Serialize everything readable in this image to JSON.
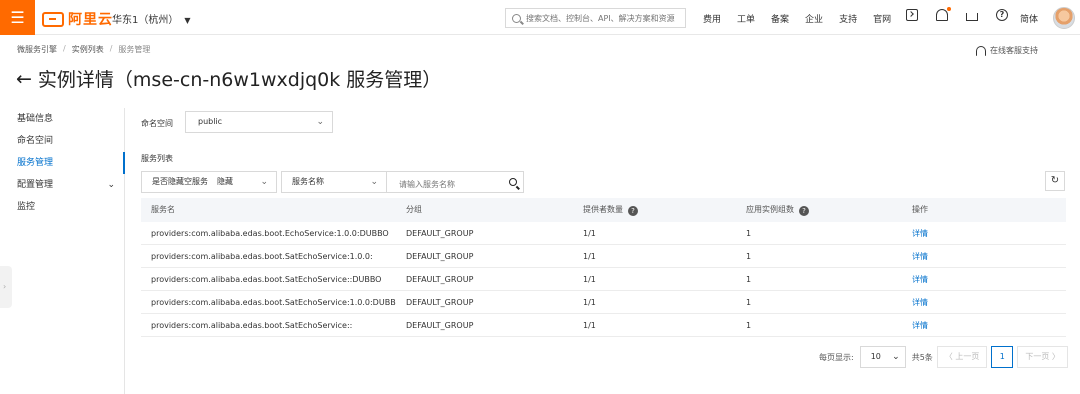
{
  "topbar": {
    "logo_text": "阿里云",
    "region": "华东1（杭州）",
    "search_placeholder": "搜索文档、控制台、API、解决方案和资源",
    "nav_links": [
      "费用",
      "工单",
      "备案",
      "企业",
      "支持",
      "官网"
    ],
    "lang": "简体",
    "accent_color": "#ff6a00"
  },
  "breadcrumb": {
    "items": [
      "微服务引擎",
      "实例列表",
      "服务管理"
    ],
    "sep": "/"
  },
  "support_label": "在线客服支持",
  "page_title": "实例详情（mse-cn-n6w1wxdjq0k 服务管理）",
  "sidebar": {
    "items": [
      {
        "label": "基础信息",
        "active": false
      },
      {
        "label": "命名空间",
        "active": false
      },
      {
        "label": "服务管理",
        "active": true
      },
      {
        "label": "配置管理",
        "active": false,
        "expandable": true
      },
      {
        "label": "监控",
        "active": false
      }
    ],
    "active_color": "#0070cc"
  },
  "namespace": {
    "label": "命名空间",
    "value": "public"
  },
  "service_list_label": "服务列表",
  "filters": {
    "hide_empty_label": "是否隐藏空服务",
    "hide_empty_value": "隐藏",
    "field_select": "服务名称",
    "search_placeholder": "请输入服务名称"
  },
  "table": {
    "columns": [
      "服务名",
      "分组",
      "提供者数量",
      "应用实例组数",
      "操作"
    ],
    "rows": [
      {
        "name": "providers:com.alibaba.edas.boot.EchoService:1.0.0:DUBBO",
        "group": "DEFAULT_GROUP",
        "providers": "1/1",
        "instances": "1",
        "action": "详情"
      },
      {
        "name": "providers:com.alibaba.edas.boot.SatEchoService:1.0.0:",
        "group": "DEFAULT_GROUP",
        "providers": "1/1",
        "instances": "1",
        "action": "详情"
      },
      {
        "name": "providers:com.alibaba.edas.boot.SatEchoService::DUBBO",
        "group": "DEFAULT_GROUP",
        "providers": "1/1",
        "instances": "1",
        "action": "详情"
      },
      {
        "name": "providers:com.alibaba.edas.boot.SatEchoService:1.0.0:DUBBO",
        "group": "DEFAULT_GROUP",
        "providers": "1/1",
        "instances": "1",
        "action": "详情"
      },
      {
        "name": "providers:com.alibaba.edas.boot.SatEchoService::",
        "group": "DEFAULT_GROUP",
        "providers": "1/1",
        "instances": "1",
        "action": "详情"
      }
    ]
  },
  "pagination": {
    "page_size_label": "每页显示:",
    "page_size": "10",
    "total": "共5条",
    "prev": "上一页",
    "next": "下一页",
    "current_page": "1"
  }
}
